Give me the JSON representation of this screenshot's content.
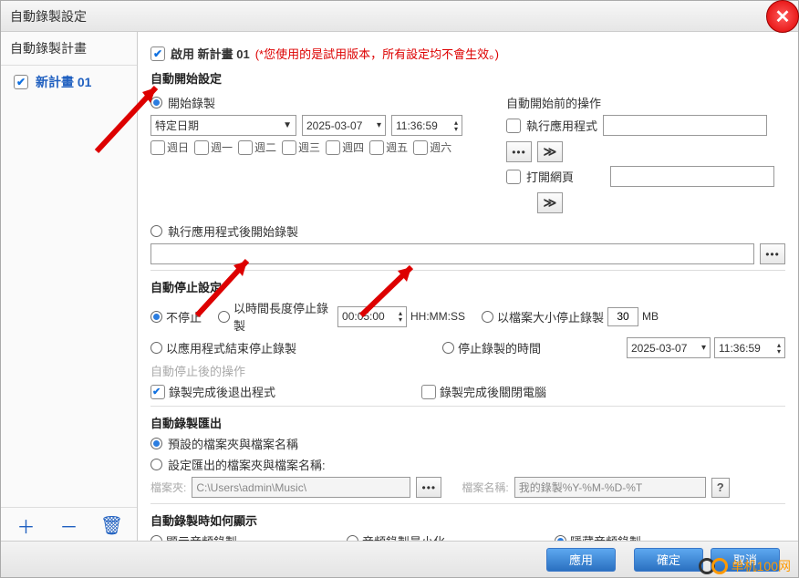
{
  "title": "自動錄製設定",
  "sidebar": {
    "header": "自動錄製計畫",
    "items": [
      "新計畫 01"
    ]
  },
  "enable": {
    "label": "啟用 新計畫 01",
    "note": "(*您使用的是試用版本，所有設定均不會生效。)"
  },
  "autostart": {
    "title": "自動開始設定",
    "r_start": "開始錄製",
    "preop_title": "自動開始前的操作",
    "datemode": "特定日期",
    "date": "2025-03-07",
    "time": "11:36:59",
    "exec_app": "執行應用程式",
    "open_web": "打開網頁",
    "days": [
      "週日",
      "週一",
      "週二",
      "週三",
      "週四",
      "週五",
      "週六"
    ],
    "r_after_app": "執行應用程式後開始錄製"
  },
  "autostop": {
    "title": "自動停止設定",
    "r_nostop": "不停止",
    "r_bytime": "以時間長度停止錄製",
    "time": "00:05:00",
    "tfmt": "HH:MM:SS",
    "r_bysize": "以檔案大小停止錄製",
    "size": "30",
    "unit": "MB",
    "r_byapp": "以應用程式結束停止錄製",
    "r_bydate": "停止錄製的時間",
    "date": "2025-03-07",
    "stime": "11:36:59",
    "after_title": "自動停止後的操作",
    "chk_exit": "錄製完成後退出程式",
    "chk_shutdown": "錄製完成後關閉電腦"
  },
  "export": {
    "title": "自動錄製匯出",
    "r_default": "預設的檔案夾與檔案名稱",
    "r_custom": "設定匯出的檔案夾與檔案名稱:",
    "folder_lbl": "檔案夾:",
    "folder": "C:\\Users\\admin\\Music\\",
    "name_lbl": "檔案名稱:",
    "name": "我的錄製%Y-%M-%D-%T"
  },
  "display": {
    "title": "自動錄製時如何顯示",
    "r_show": "顯示音頻錄製",
    "r_min": "音頻錄製最小化",
    "r_hide": "隱藏音頻錄製"
  },
  "buttons": {
    "apply": "應用",
    "ok": "確定",
    "cancel": "取消"
  },
  "watermark": "单机100网"
}
